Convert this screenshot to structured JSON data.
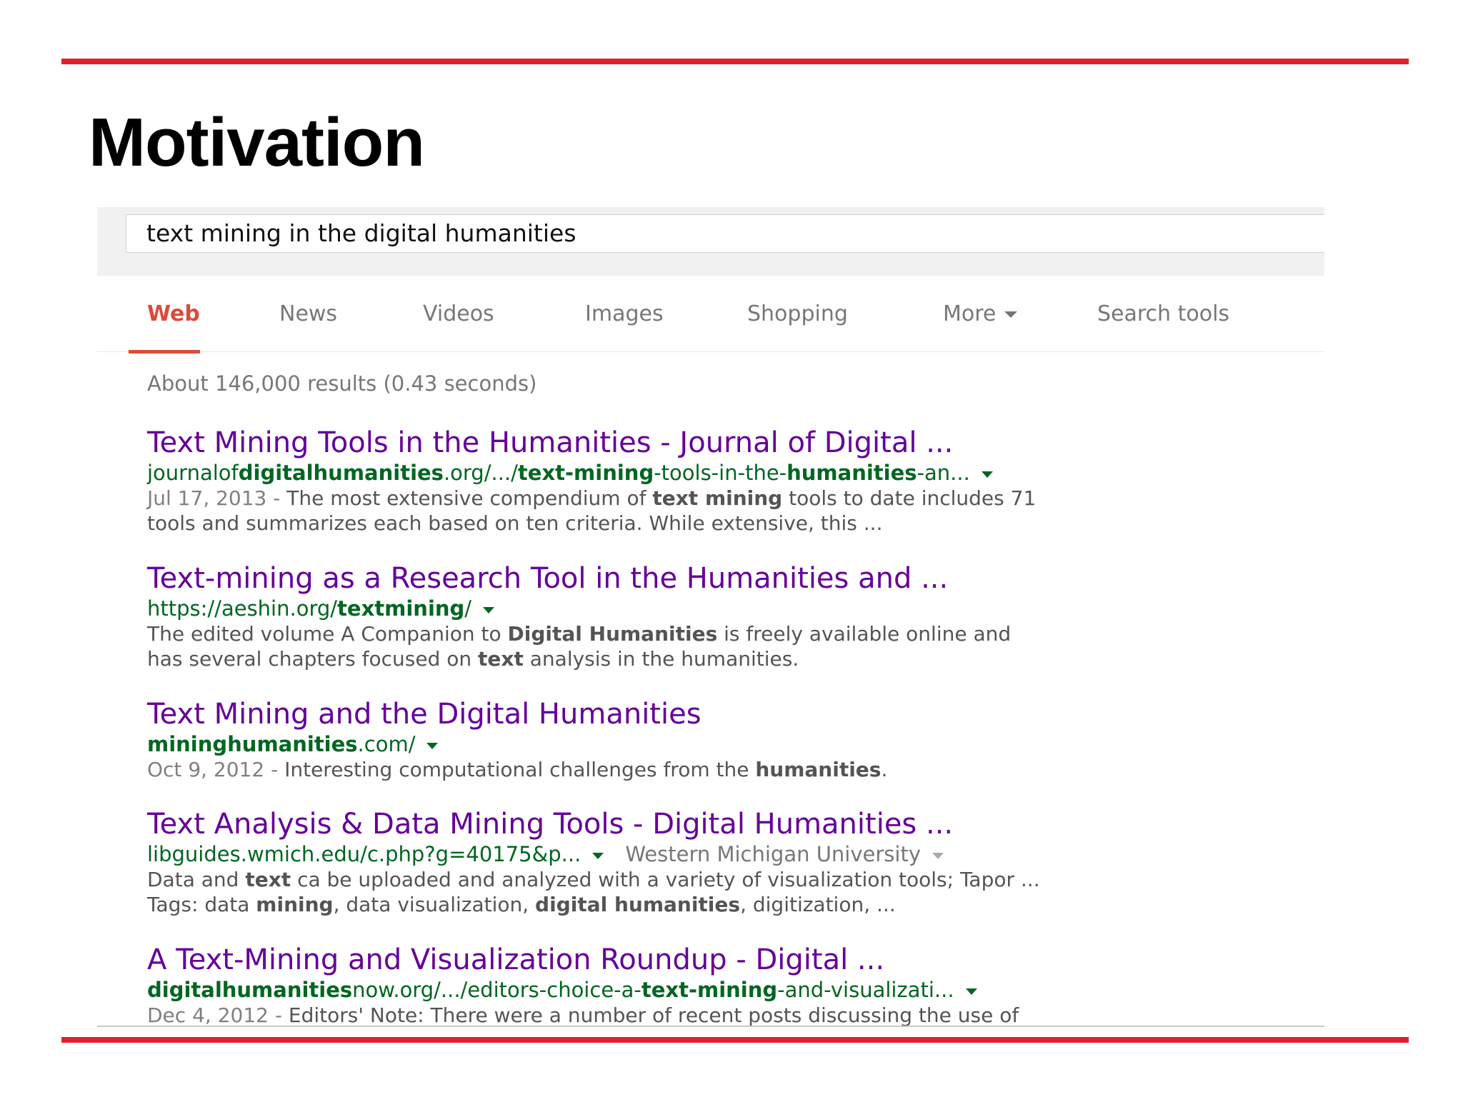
{
  "slide": {
    "title": "Motivation"
  },
  "search": {
    "query": "text mining in the digital humanities"
  },
  "tabs": [
    {
      "label": "Web",
      "active": true
    },
    {
      "label": "News"
    },
    {
      "label": "Videos"
    },
    {
      "label": "Images"
    },
    {
      "label": "Shopping"
    },
    {
      "label": "More"
    },
    {
      "label": "Search tools"
    }
  ],
  "stats": "About 146,000 results (0.43 seconds)",
  "results": [
    {
      "title": "Text Mining Tools in the Humanities - Journal of Digital ...",
      "url": {
        "p1": "journalof",
        "b1": "digitalhumanities",
        "p2": ".org/.../",
        "b2": "text-mining",
        "p3": "-tools-in-the-",
        "b3": "humanities",
        "p4": "-an..."
      },
      "snippet1": {
        "date": "Jul 17, 2013",
        "sep": " - ",
        "t1": "The most extensive compendium of ",
        "b1": "text mining",
        "t2": " tools to date includes 71"
      },
      "snippet2": "tools and summarizes each based on ten criteria. While extensive, this ..."
    },
    {
      "title": "Text-mining as a Research Tool in the Humanities and ...",
      "url": {
        "p1": "https://aeshin.org/",
        "b1": "textmining",
        "p2": "/"
      },
      "snippet1": {
        "t1": "The edited volume A Companion to ",
        "b1": "Digital Humanities",
        "t2": " is freely available online and"
      },
      "snippet2": {
        "t1": "has several chapters focused on ",
        "b1": "text",
        "t2": " analysis in the humanities."
      }
    },
    {
      "title": "Text Mining and the Digital Humanities",
      "url": {
        "b1": "mininghumanities",
        "p1": ".com/"
      },
      "snippet1": {
        "date": "Oct 9, 2012",
        "sep": " - ",
        "t1": "Interesting computational challenges from the ",
        "b1": "humanities",
        "t2": "."
      }
    },
    {
      "title": "Text Analysis & Data Mining Tools - Digital Humanities ...",
      "url": {
        "p1": "libguides.wmich.edu/c.php?g=40175&p...",
        "source": "Western Michigan University"
      },
      "snippet1": {
        "t1": "Data and ",
        "b1": "text",
        "t2": " ca be uploaded and analyzed with a variety of visualization tools; Tapor ..."
      },
      "snippet2": {
        "t1": "Tags: data ",
        "b1": "mining",
        "t2": ", data visualization, ",
        "b2": "digital humanities",
        "t3": ", digitization, ..."
      }
    },
    {
      "title": "A Text-Mining and Visualization Roundup - Digital ...",
      "url": {
        "b1": "digitalhumanities",
        "p1": "now.org/.../editors-choice-a-",
        "b2": "text-mining",
        "p2": "-and-visualizati..."
      },
      "snippet1": {
        "date": "Dec 4, 2012",
        "sep": " - ",
        "t1": "Editors' Note: There were a number of recent posts discussing the use of"
      }
    }
  ]
}
